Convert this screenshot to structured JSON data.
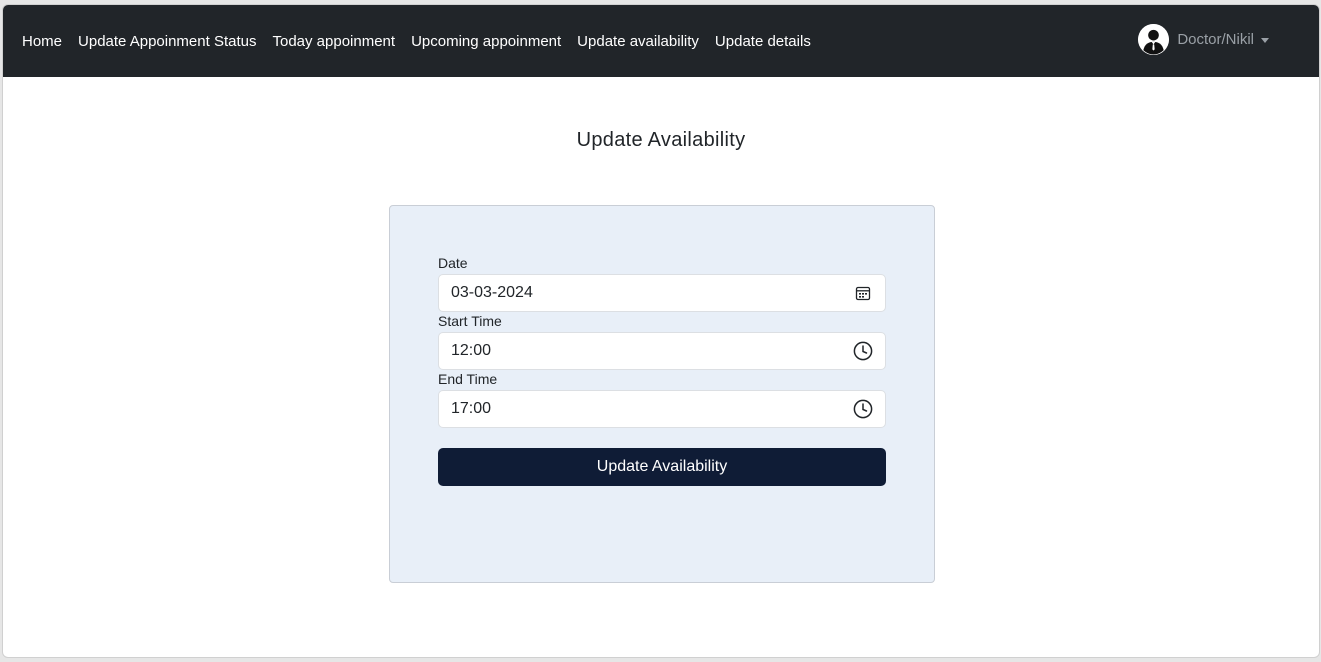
{
  "navbar": {
    "links": [
      {
        "label": "Home"
      },
      {
        "label": "Update Appoinment Status"
      },
      {
        "label": "Today appoinment"
      },
      {
        "label": "Upcoming appoinment"
      },
      {
        "label": "Update availability"
      },
      {
        "label": "Update details"
      }
    ],
    "user": {
      "name": "Doctor/Nikil",
      "avatar_icon": "user-avatar-icon"
    },
    "background_color": "#212529"
  },
  "main": {
    "title": "Update Availability",
    "form": {
      "date": {
        "label": "Date",
        "value": "03-03-2024",
        "icon": "calendar-icon"
      },
      "start_time": {
        "label": "Start Time",
        "value": "12:00",
        "icon": "clock-icon"
      },
      "end_time": {
        "label": "End Time",
        "value": "17:00",
        "icon": "clock-icon"
      },
      "submit_label": "Update Availability",
      "card_background": "#e8eff8",
      "button_color": "#0f1c36"
    }
  }
}
